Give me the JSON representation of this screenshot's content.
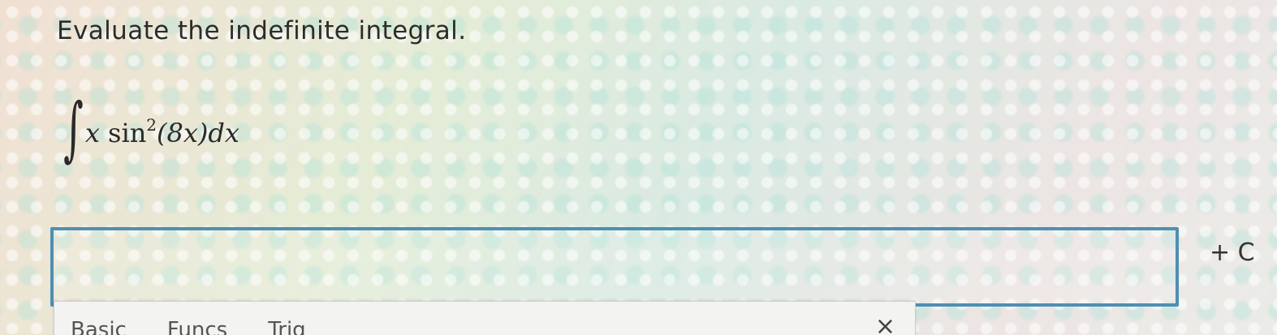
{
  "question": {
    "prompt": "Evaluate the indefinite integral.",
    "integral_sign": "∫",
    "integrand_var": "x",
    "integrand_func": "sin",
    "integrand_power": "2",
    "integrand_arg": "(8x)",
    "differential": "dx"
  },
  "answer": {
    "value": "",
    "constant_label": "+ C"
  },
  "keyboard_panel": {
    "tabs": [
      "Basic",
      "Funcs",
      "Trig"
    ],
    "close_icon": "close-icon",
    "close_glyph": "×"
  },
  "colors": {
    "answer_border": "#4f8fb3"
  }
}
